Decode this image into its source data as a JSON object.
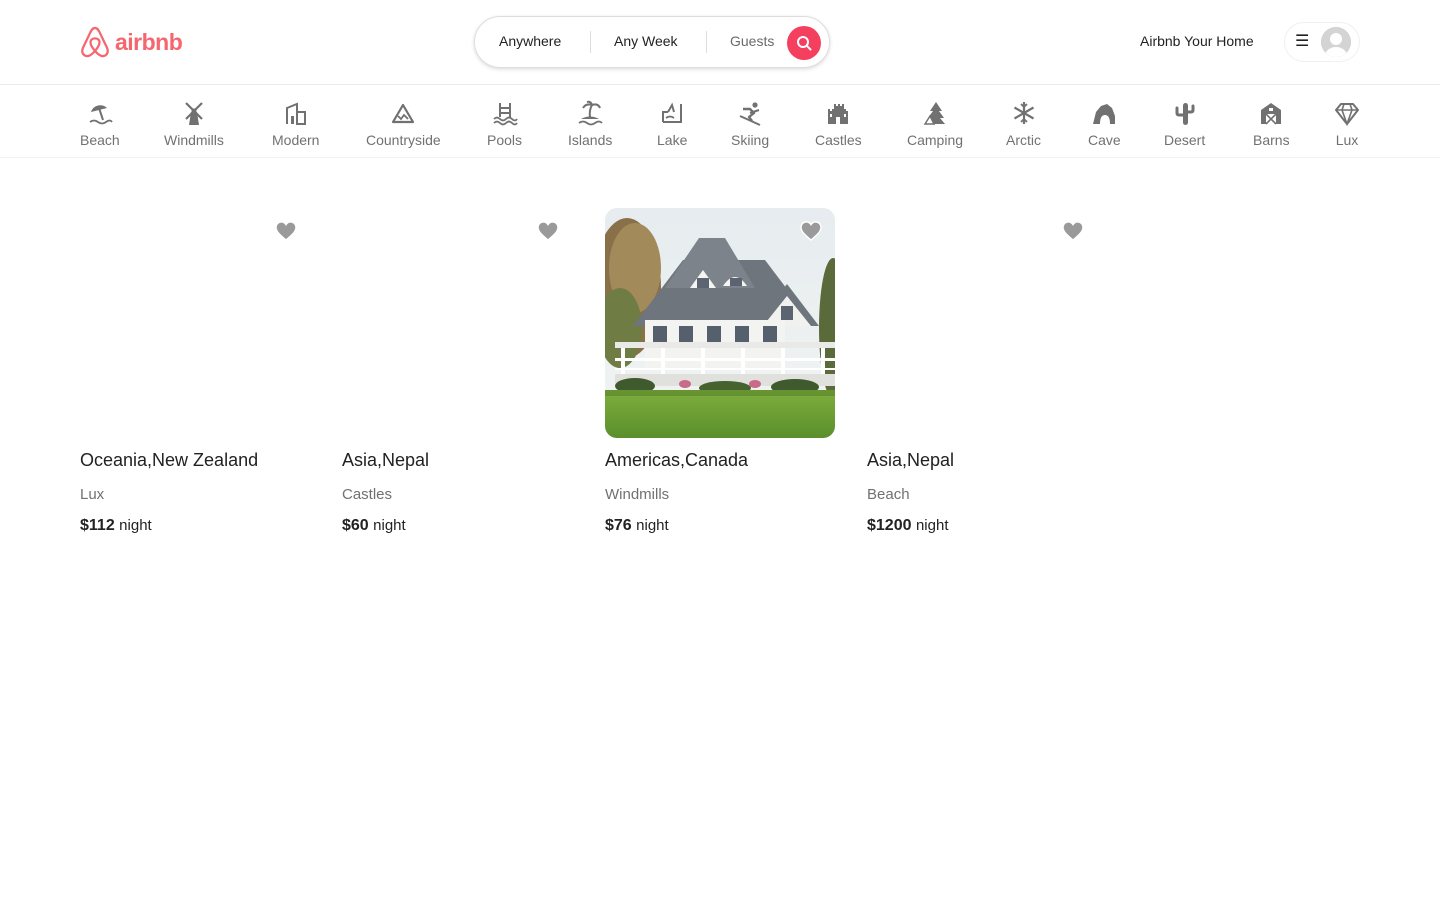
{
  "brand": {
    "name": "airbnb",
    "color": "#f5666e"
  },
  "search": {
    "location": "Anywhere",
    "dates": "Any Week",
    "guests": "Guests",
    "button_color": "#f43f5e",
    "icon": "search-icon"
  },
  "header": {
    "host_link": "Airbnb Your Home",
    "menu_icon": "☰",
    "avatar_icon": "user-avatar-placeholder"
  },
  "categories": [
    {
      "label": "Beach",
      "icon": "beach-umbrella-icon"
    },
    {
      "label": "Windmills",
      "icon": "windmill-icon"
    },
    {
      "label": "Modern",
      "icon": "modern-building-icon"
    },
    {
      "label": "Countryside",
      "icon": "mountain-icon"
    },
    {
      "label": "Pools",
      "icon": "pool-icon"
    },
    {
      "label": "Islands",
      "icon": "island-icon"
    },
    {
      "label": "Lake",
      "icon": "lake-icon"
    },
    {
      "label": "Skiing",
      "icon": "skiing-icon"
    },
    {
      "label": "Castles",
      "icon": "castle-icon"
    },
    {
      "label": "Camping",
      "icon": "camping-icon"
    },
    {
      "label": "Arctic",
      "icon": "snowflake-icon"
    },
    {
      "label": "Cave",
      "icon": "cave-icon"
    },
    {
      "label": "Desert",
      "icon": "cactus-icon"
    },
    {
      "label": "Barns",
      "icon": "barn-icon"
    },
    {
      "label": "Lux",
      "icon": "diamond-icon"
    }
  ],
  "listings": [
    {
      "location": "Oceania,New Zealand",
      "category": "Lux",
      "price": "$112",
      "price_unit": "night",
      "has_image": false
    },
    {
      "location": "Asia,Nepal",
      "category": "Castles",
      "price": "$60",
      "price_unit": "night",
      "has_image": false
    },
    {
      "location": "Americas,Canada",
      "category": "Windmills",
      "price": "$76",
      "price_unit": "night",
      "has_image": true
    },
    {
      "location": "Asia,Nepal",
      "category": "Beach",
      "price": "$1200",
      "price_unit": "night",
      "has_image": false
    }
  ]
}
